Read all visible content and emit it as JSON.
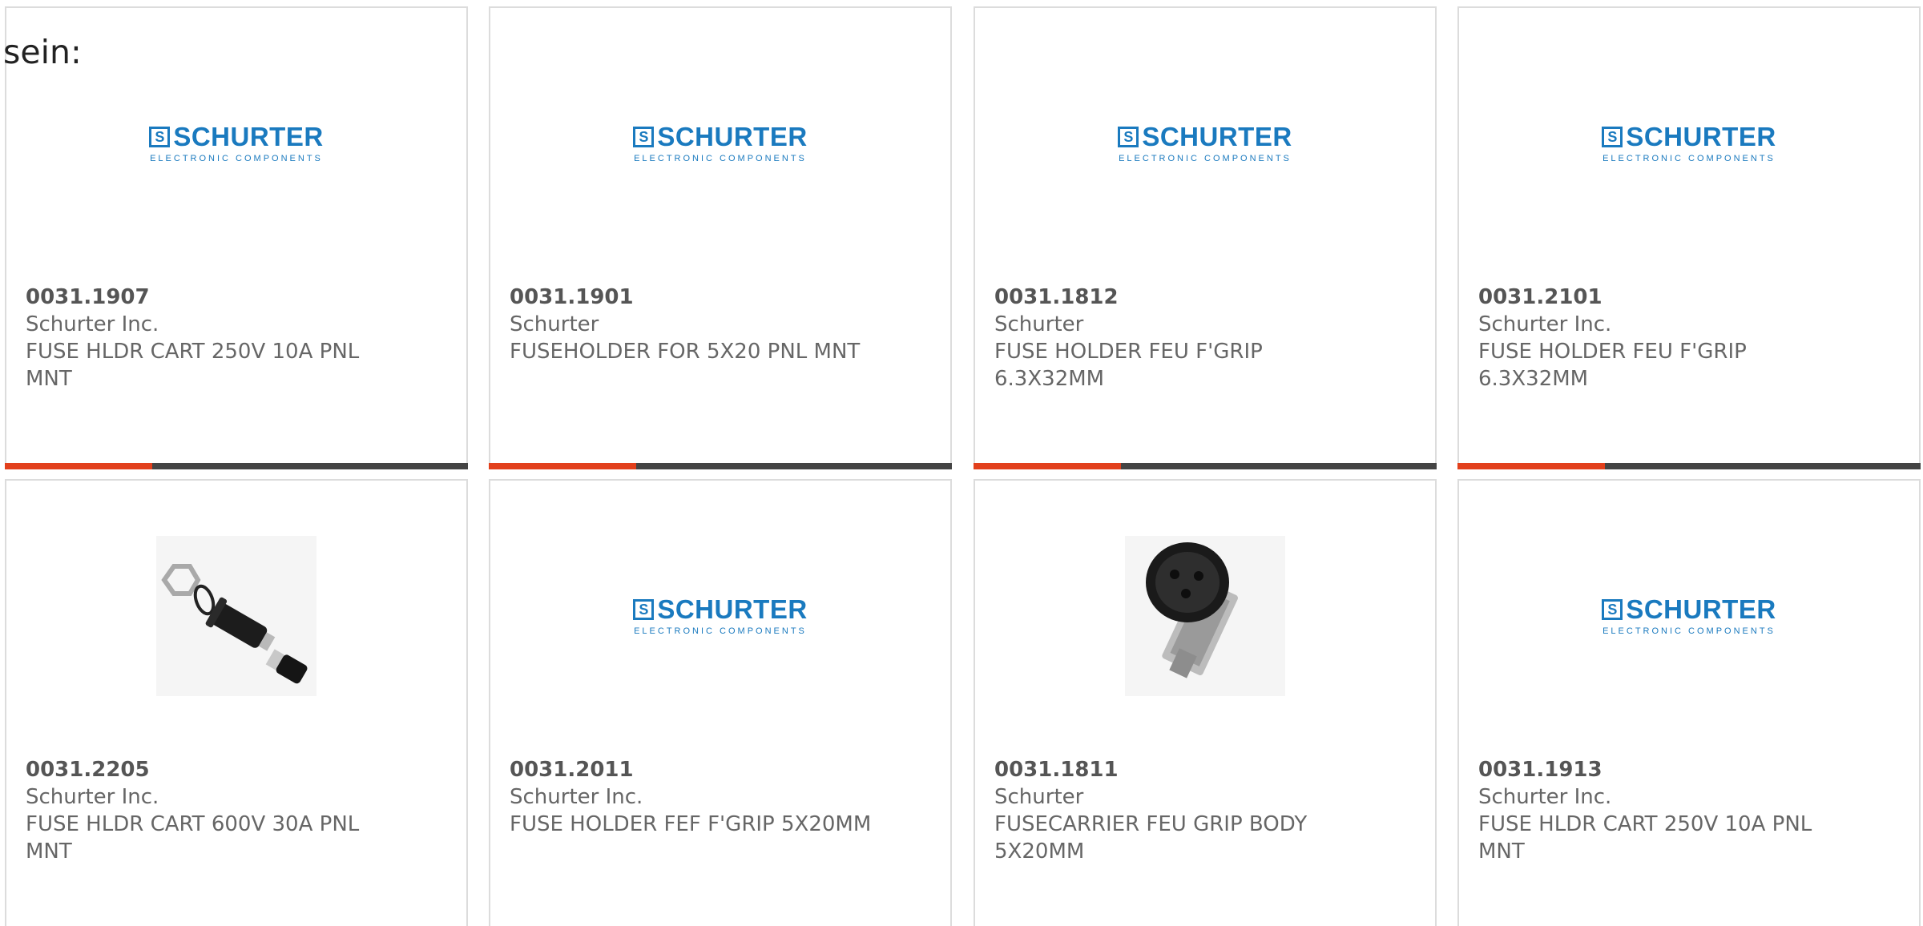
{
  "heading": "sein:",
  "brand": {
    "name": "SCHURTER",
    "mark": "S",
    "tagline": "ELECTRONIC COMPONENTS",
    "color": "#1a7abf"
  },
  "accent_color": "#e2401c",
  "products": [
    {
      "part_number": "0031.1907",
      "manufacturer": "Schurter Inc.",
      "description": "FUSE HLDR CART 250V 10A PNL MNT",
      "image": "schurter-logo"
    },
    {
      "part_number": "0031.1901",
      "manufacturer": "Schurter",
      "description": "FUSEHOLDER FOR 5X20 PNL MNT",
      "image": "schurter-logo"
    },
    {
      "part_number": "0031.1812",
      "manufacturer": "Schurter",
      "description": "FUSE HOLDER FEU F'GRIP 6.3X32MM",
      "image": "schurter-logo"
    },
    {
      "part_number": "0031.2101",
      "manufacturer": "Schurter Inc.",
      "description": "FUSE HOLDER FEU F'GRIP 6.3X32MM",
      "image": "schurter-logo"
    },
    {
      "part_number": "0031.2205",
      "manufacturer": "Schurter Inc.",
      "description": "FUSE HLDR CART 600V 30A PNL MNT",
      "image": "fuse-holder-kit-photo"
    },
    {
      "part_number": "0031.2011",
      "manufacturer": "Schurter Inc.",
      "description": "FUSE HOLDER FEF F'GRIP 5X20MM",
      "image": "schurter-logo"
    },
    {
      "part_number": "0031.1811",
      "manufacturer": "Schurter",
      "description": "FUSECARRIER FEU GRIP BODY 5X20MM",
      "image": "fuse-carrier-photo"
    },
    {
      "part_number": "0031.1913",
      "manufacturer": "Schurter Inc.",
      "description": "FUSE HLDR CART 250V 10A PNL MNT",
      "image": "schurter-logo"
    }
  ]
}
